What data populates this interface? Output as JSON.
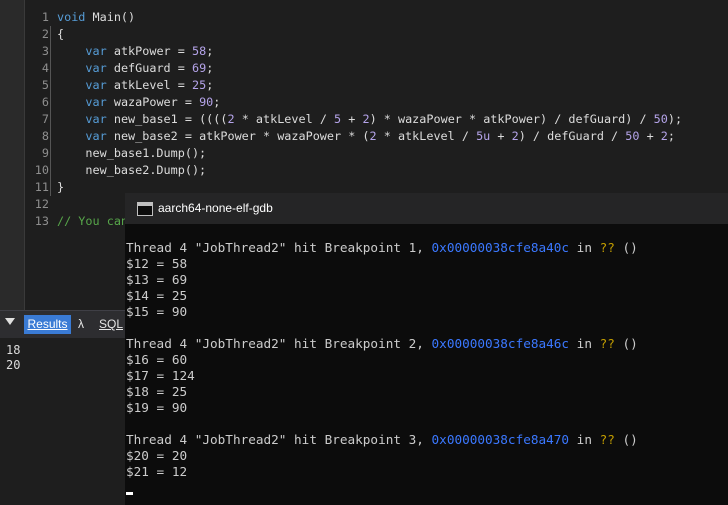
{
  "editor": {
    "lines": [
      {
        "n": "1",
        "tokens": [
          {
            "t": "void",
            "c": "kw"
          },
          {
            "t": " Main()",
            "c": ""
          }
        ]
      },
      {
        "n": "2",
        "tokens": [
          {
            "t": "{",
            "c": ""
          }
        ]
      },
      {
        "n": "3",
        "tokens": [
          {
            "t": "    ",
            "c": ""
          },
          {
            "t": "var",
            "c": "kw"
          },
          {
            "t": " atkPower = ",
            "c": ""
          },
          {
            "t": "58",
            "c": "num"
          },
          {
            "t": ";",
            "c": ""
          }
        ]
      },
      {
        "n": "4",
        "tokens": [
          {
            "t": "    ",
            "c": ""
          },
          {
            "t": "var",
            "c": "kw"
          },
          {
            "t": " defGuard = ",
            "c": ""
          },
          {
            "t": "69",
            "c": "num"
          },
          {
            "t": ";",
            "c": ""
          }
        ]
      },
      {
        "n": "5",
        "tokens": [
          {
            "t": "    ",
            "c": ""
          },
          {
            "t": "var",
            "c": "kw"
          },
          {
            "t": " atkLevel = ",
            "c": ""
          },
          {
            "t": "25",
            "c": "num"
          },
          {
            "t": ";",
            "c": ""
          }
        ]
      },
      {
        "n": "6",
        "tokens": [
          {
            "t": "    ",
            "c": ""
          },
          {
            "t": "var",
            "c": "kw"
          },
          {
            "t": " wazaPower = ",
            "c": ""
          },
          {
            "t": "90",
            "c": "num"
          },
          {
            "t": ";",
            "c": ""
          }
        ]
      },
      {
        "n": "7",
        "tokens": [
          {
            "t": "    ",
            "c": ""
          },
          {
            "t": "var",
            "c": "kw"
          },
          {
            "t": " new_base1 = ((((",
            "c": ""
          },
          {
            "t": "2",
            "c": "num"
          },
          {
            "t": " * atkLevel / ",
            "c": ""
          },
          {
            "t": "5",
            "c": "num"
          },
          {
            "t": " + ",
            "c": ""
          },
          {
            "t": "2",
            "c": "num"
          },
          {
            "t": ") * wazaPower * atkPower) / defGuard) / ",
            "c": ""
          },
          {
            "t": "50",
            "c": "num"
          },
          {
            "t": ");",
            "c": ""
          }
        ]
      },
      {
        "n": "8",
        "tokens": [
          {
            "t": "    ",
            "c": ""
          },
          {
            "t": "var",
            "c": "kw"
          },
          {
            "t": " new_base2 = atkPower * wazaPower * (",
            "c": ""
          },
          {
            "t": "2",
            "c": "num"
          },
          {
            "t": " * atkLevel / ",
            "c": ""
          },
          {
            "t": "5u",
            "c": "num"
          },
          {
            "t": " + ",
            "c": ""
          },
          {
            "t": "2",
            "c": "num"
          },
          {
            "t": ") / defGuard / ",
            "c": ""
          },
          {
            "t": "50",
            "c": "num"
          },
          {
            "t": " + ",
            "c": ""
          },
          {
            "t": "2",
            "c": "num"
          },
          {
            "t": ";",
            "c": ""
          }
        ]
      },
      {
        "n": "9",
        "tokens": [
          {
            "t": "    new_base1.Dump();",
            "c": ""
          }
        ]
      },
      {
        "n": "10",
        "tokens": [
          {
            "t": "    new_base2.Dump();",
            "c": ""
          }
        ]
      },
      {
        "n": "11",
        "tokens": [
          {
            "t": "}",
            "c": ""
          }
        ]
      },
      {
        "n": "12",
        "tokens": []
      },
      {
        "n": "13",
        "tokens": [
          {
            "t": "// You can",
            "c": "cmt"
          }
        ]
      }
    ]
  },
  "results": {
    "tabs": {
      "results": "Results",
      "lambda": "λ",
      "sql": "SQL"
    },
    "output": [
      "18",
      "20"
    ]
  },
  "gdb": {
    "title": "aarch64-none-elf-gdb",
    "lines": [
      [
        {
          "t": "Thread 4 \"JobThread2\" hit Breakpoint 1, ",
          "c": ""
        },
        {
          "t": "0x00000038cfe8a40c",
          "c": "addr"
        },
        {
          "t": " in ",
          "c": ""
        },
        {
          "t": "??",
          "c": "qq"
        },
        {
          "t": " ()",
          "c": ""
        }
      ],
      [
        {
          "t": "$12 = 58",
          "c": ""
        }
      ],
      [
        {
          "t": "$13 = 69",
          "c": ""
        }
      ],
      [
        {
          "t": "$14 = 25",
          "c": ""
        }
      ],
      [
        {
          "t": "$15 = 90",
          "c": ""
        }
      ],
      [],
      [
        {
          "t": "Thread 4 \"JobThread2\" hit Breakpoint 2, ",
          "c": ""
        },
        {
          "t": "0x00000038cfe8a46c",
          "c": "addr"
        },
        {
          "t": " in ",
          "c": ""
        },
        {
          "t": "??",
          "c": "qq"
        },
        {
          "t": " ()",
          "c": ""
        }
      ],
      [
        {
          "t": "$16 = 60",
          "c": ""
        }
      ],
      [
        {
          "t": "$17 = 124",
          "c": ""
        }
      ],
      [
        {
          "t": "$18 = 25",
          "c": ""
        }
      ],
      [
        {
          "t": "$19 = 90",
          "c": ""
        }
      ],
      [],
      [
        {
          "t": "Thread 4 \"JobThread2\" hit Breakpoint 3, ",
          "c": ""
        },
        {
          "t": "0x00000038cfe8a470",
          "c": "addr"
        },
        {
          "t": " in ",
          "c": ""
        },
        {
          "t": "??",
          "c": "qq"
        },
        {
          "t": " ()",
          "c": ""
        }
      ],
      [
        {
          "t": "$20 = 20",
          "c": ""
        }
      ],
      [
        {
          "t": "$21 = 12",
          "c": ""
        }
      ]
    ]
  }
}
